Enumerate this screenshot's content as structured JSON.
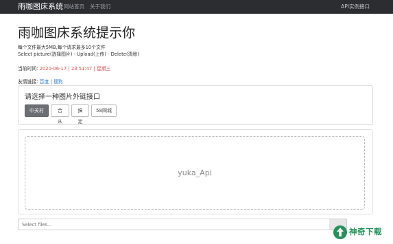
{
  "navbar": {
    "brand": "雨咖图床系统",
    "links": [
      "网站首页",
      "关于我们"
    ],
    "right_link": "API实例接口"
  },
  "header": {
    "title": "雨咖图床系统提示你",
    "limits": "每个文件最大5MB,每个请求最多10个文件",
    "steps": "Select picture(选择图片) - Upload(上传) - Delete(清除)"
  },
  "time": {
    "label": "当前时间:",
    "date": "2020-06-17",
    "clock": "23:51:47",
    "weekday": "星期三",
    "separator": "|"
  },
  "friend_links": {
    "label": "友情链接:",
    "items": [
      "百度",
      "搜狗"
    ],
    "separator": "|"
  },
  "select_api": {
    "heading": "请选择一种图片外链接口",
    "options": [
      "中关村",
      "合从",
      "搞定",
      "58同城"
    ],
    "active_index": 0
  },
  "upload": {
    "dropzone_text": "yuka_Api",
    "file_placeholder": "Select files..."
  },
  "watermark": {
    "text": "神奇下载",
    "color": "#25925a"
  },
  "colors": {
    "navbar_bg": "#2b2d31",
    "accent_red": "#e34848",
    "link_blue": "#2a7ad6",
    "active_button": "#6b6e73"
  }
}
